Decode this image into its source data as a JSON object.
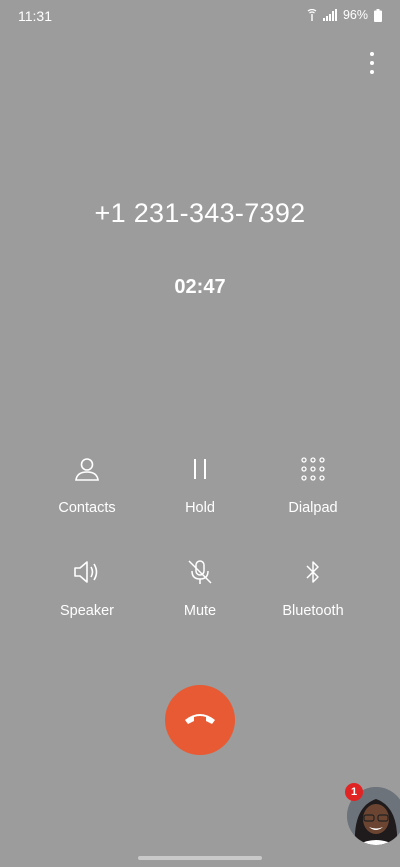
{
  "status_bar": {
    "time": "11:31",
    "battery": "96%",
    "icons": [
      "wifi-call-icon",
      "signal-icon",
      "battery-icon"
    ]
  },
  "call": {
    "number": "+1 231-343-7392",
    "duration": "02:47"
  },
  "actions": [
    {
      "label": "Contacts",
      "icon": "contacts-icon"
    },
    {
      "label": "Hold",
      "icon": "pause-icon"
    },
    {
      "label": "Dialpad",
      "icon": "dialpad-icon"
    },
    {
      "label": "Speaker",
      "icon": "speaker-icon"
    },
    {
      "label": "Mute",
      "icon": "mic-off-icon"
    },
    {
      "label": "Bluetooth",
      "icon": "bluetooth-icon"
    }
  ],
  "end_call": {
    "icon": "end-call-icon",
    "color": "#e85a33"
  },
  "bubble": {
    "badge_count": "1"
  },
  "colors": {
    "background": "#9c9c9c",
    "end_call": "#e85a33",
    "badge": "#e02424"
  }
}
